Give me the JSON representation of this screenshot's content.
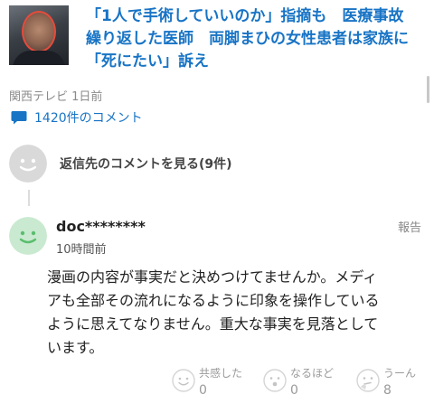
{
  "article": {
    "title_lines": [
      "「1人で手術していいのか」指摘も　医療事故",
      "繰り返した医師　両脚まひの女性患者は家族に",
      "「死にたい」訴え"
    ],
    "source": "関西テレビ 1日前",
    "comment_count_label": "1420件のコメント"
  },
  "reply_link": {
    "label": "返信先のコメントを見る(9件)"
  },
  "comment": {
    "user": "doc********",
    "time": "10時間前",
    "report_label": "報告",
    "body_lines": [
      "漫画の内容が事実だと決めつけてませんか。メディ",
      "アも全部その流れになるように印象を操作している",
      "ように思えてなりません。重大な事実を見落として",
      "います。"
    ],
    "reactions": [
      {
        "label": "共感した",
        "count": "0",
        "icon": "smile-icon"
      },
      {
        "label": "なるほど",
        "count": "0",
        "icon": "surprised-icon"
      },
      {
        "label": "うーん",
        "count": "8",
        "icon": "thinking-icon"
      }
    ]
  },
  "colors": {
    "link_blue": "#1874c5",
    "avatar_green": "#c9ead0",
    "avatar_green_face": "#5bbd6e",
    "avatar_gray": "#d9d9d9",
    "muted_text": "#9a9a9a"
  }
}
